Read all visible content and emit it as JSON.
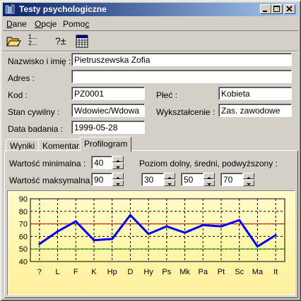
{
  "window": {
    "title": "Testy psychologiczne"
  },
  "menu": [
    {
      "pre": "",
      "u": "D",
      "post": "ane"
    },
    {
      "pre": "",
      "u": "O",
      "post": "pcje"
    },
    {
      "pre": "Pomo",
      "u": "c",
      "post": ""
    }
  ],
  "toolbar": {
    "open_icon": "folder-open-icon",
    "numbered_icon_text": [
      "1...",
      "2..."
    ],
    "help_icon_text": "?±",
    "calendar_icon": "calendar-icon"
  },
  "form": {
    "name_label": "Nazwisko i imię :",
    "name_value": "Pietruszewska Zofia",
    "address_label": "Adres :",
    "address_value": "",
    "code_label": "Kod :",
    "code_value": "PZ0001",
    "sex_label": "Płeć :",
    "sex_value": "Kobieta",
    "marital_label": "Stan cywilny :",
    "marital_value": "Wdowiec/Wdowa",
    "education_label": "Wykształcenie :",
    "education_value": "Zas. zawodowe",
    "date_label": "Data badania :",
    "date_value": "1999-05-28"
  },
  "tabs": [
    "Wyniki",
    "Komentarz",
    "Profilogram"
  ],
  "profil": {
    "min_label": "Wartość minimalna :",
    "min_value": "40",
    "max_label": "Wartość maksymalna :",
    "max_value": "90",
    "levels_label": "Poziom dolny, średni, podwyższony :",
    "level_low": "30",
    "level_mid": "50",
    "level_high": "70"
  },
  "colors": {
    "line": "#0000ff",
    "upper_ref": "#cc0000",
    "lower_ref": "#008000"
  },
  "chart_data": {
    "type": "line",
    "categories": [
      "?",
      "L",
      "F",
      "K",
      "Hp",
      "D",
      "Hy",
      "Ps",
      "Mk",
      "Pa",
      "Pt",
      "Sc",
      "Ma",
      "It"
    ],
    "values": [
      54,
      64,
      72,
      57,
      58,
      77,
      62,
      68,
      63,
      69,
      68,
      73,
      52,
      61
    ],
    "yticks": [
      "90",
      "80",
      "70",
      "60",
      "50",
      "40"
    ],
    "ylim": [
      40,
      90
    ],
    "reference_lines": [
      70,
      50
    ],
    "grid": true
  }
}
